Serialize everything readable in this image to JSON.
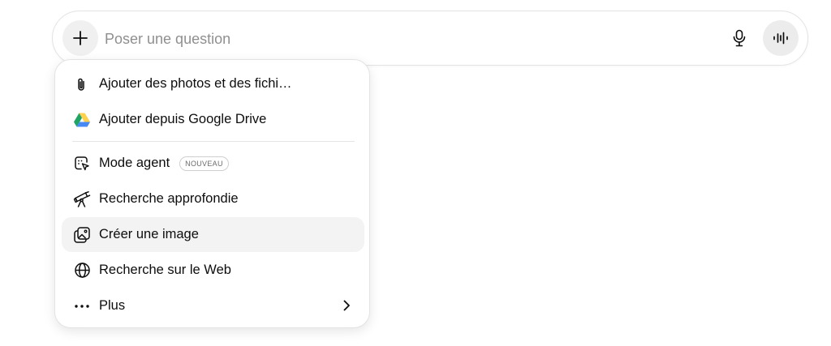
{
  "composer": {
    "placeholder": "Poser une question",
    "plus_icon": "plus-icon",
    "mic_icon": "microphone-icon",
    "voice_icon": "voice-waveform-icon"
  },
  "menu": {
    "items": [
      {
        "label": "Ajouter des photos et des fichi…",
        "icon": "paperclip-icon"
      },
      {
        "label": "Ajouter depuis Google Drive",
        "icon": "google-drive-icon"
      },
      {
        "label": "Mode agent",
        "icon": "agent-cursor-icon",
        "badge": "NOUVEAU"
      },
      {
        "label": "Recherche approfondie",
        "icon": "telescope-icon"
      },
      {
        "label": "Créer une image",
        "icon": "image-create-icon",
        "highlighted": true
      },
      {
        "label": "Recherche sur le Web",
        "icon": "globe-icon"
      },
      {
        "label": "Plus",
        "icon": "more-dots-icon",
        "trailing_icon": "chevron-right-icon"
      }
    ]
  },
  "colors": {
    "text": "#0d0d0d",
    "placeholder": "#8f8f8f",
    "border": "#e3e3e3",
    "highlight": "#f3f3f3",
    "drive_green": "#1fa463",
    "drive_yellow": "#ffd04b",
    "drive_blue": "#4688f4"
  }
}
